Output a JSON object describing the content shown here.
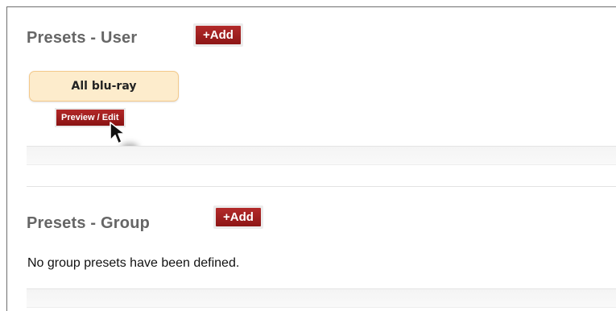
{
  "user_section": {
    "title": "Presets - User",
    "add_label": "+Add",
    "presets": [
      {
        "label": "All blu-ray",
        "action_label": "Preview / Edit"
      }
    ]
  },
  "group_section": {
    "title": "Presets - Group",
    "add_label": "+Add",
    "empty_message": "No group presets have been defined."
  },
  "colors": {
    "button_red": "#9e1f1f",
    "preset_fill": "#fdeccc",
    "preset_border": "#f3c98b",
    "title_gray": "#666666"
  },
  "icons": {
    "cursor": "mouse-pointer-icon"
  }
}
